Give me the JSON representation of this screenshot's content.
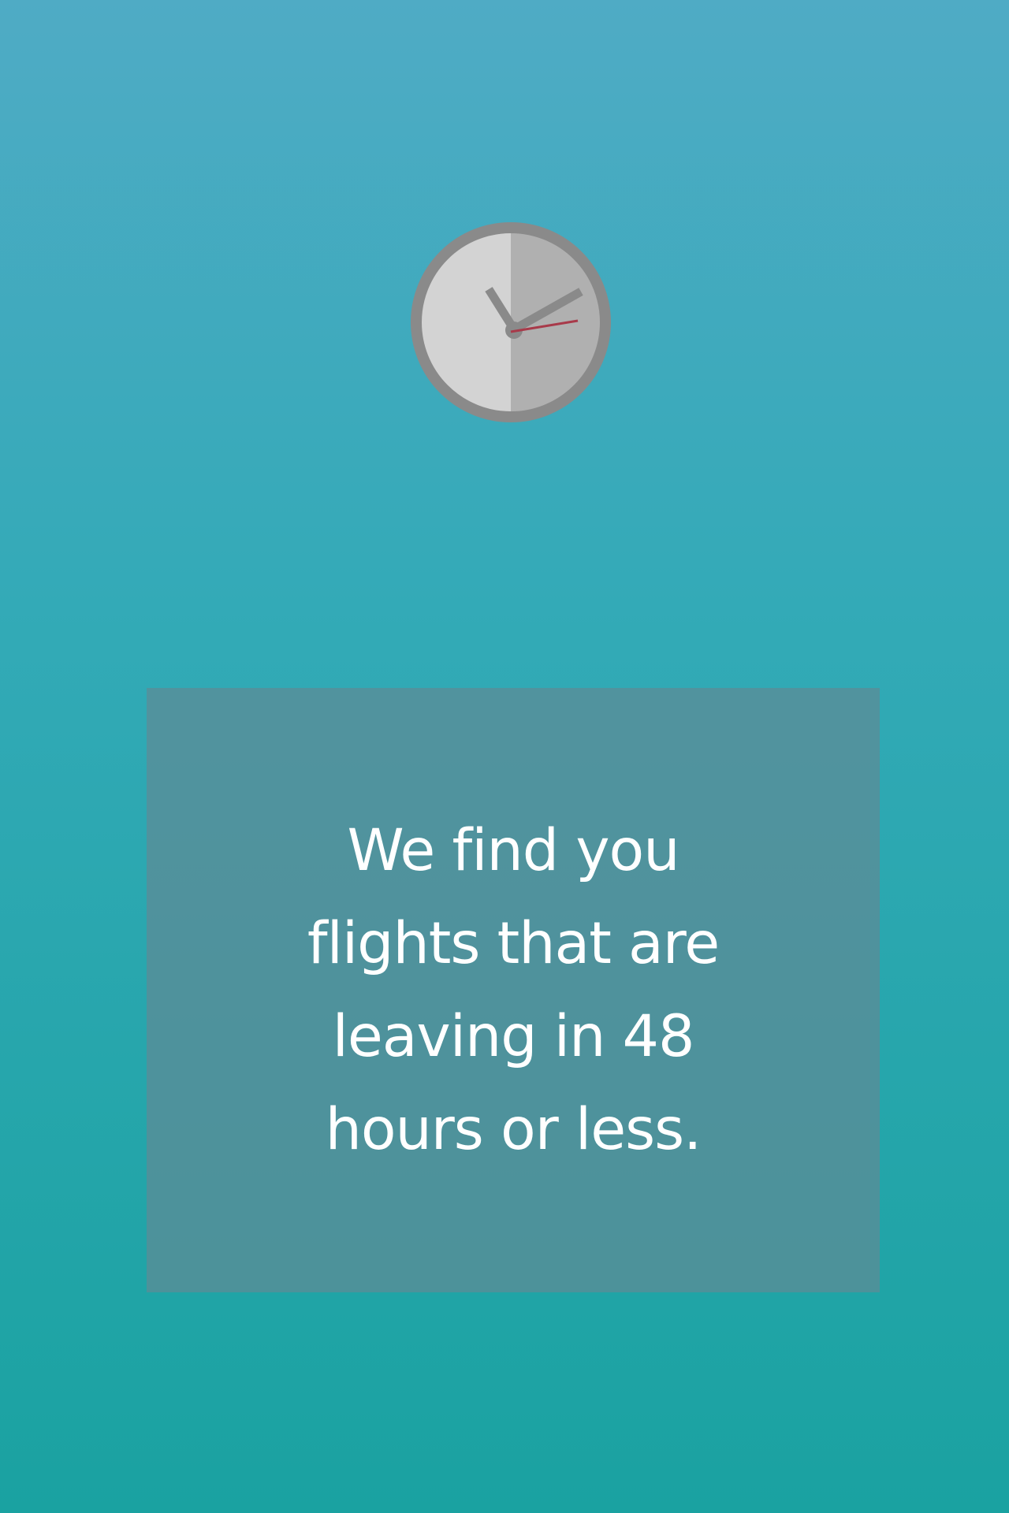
{
  "screen": {
    "message": "We find you flights that are leaving in 48 hours or less."
  },
  "icons": {
    "clock": "clock-icon"
  },
  "colors": {
    "gradient_top": "#4fabc5",
    "gradient_bottom": "#1aa2a1",
    "panel": "#5e8a96",
    "clock_ring": "#8a8a8a",
    "clock_face_light": "#d3d3d3",
    "clock_face_dark": "#b0b0b0",
    "second_hand": "#a83a4a",
    "text": "#ffffff"
  }
}
